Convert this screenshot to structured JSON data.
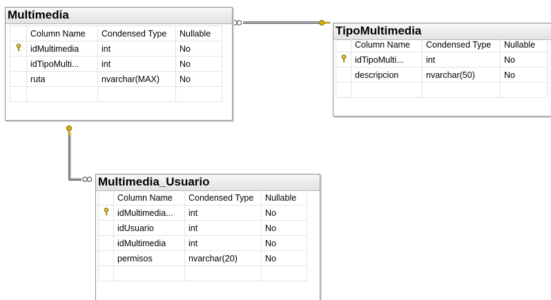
{
  "tables": {
    "multimedia": {
      "title": "Multimedia",
      "headers": [
        "Column Name",
        "Condensed Type",
        "Nullable"
      ],
      "rows": [
        {
          "key": true,
          "name": "idMultimedia",
          "type": "int",
          "nullable": "No"
        },
        {
          "key": false,
          "name": "idTipoMulti...",
          "type": "int",
          "nullable": "No"
        },
        {
          "key": false,
          "name": "ruta",
          "type": "nvarchar(MAX)",
          "nullable": "No"
        }
      ]
    },
    "tipo": {
      "title": "TipoMultimedia",
      "headers": [
        "Column Name",
        "Condensed Type",
        "Nullable"
      ],
      "rows": [
        {
          "key": true,
          "name": "idTipoMulti...",
          "type": "int",
          "nullable": "No"
        },
        {
          "key": false,
          "name": "descripcion",
          "type": "nvarchar(50)",
          "nullable": "No"
        }
      ]
    },
    "usuario": {
      "title": "Multimedia_Usuario",
      "headers": [
        "Column Name",
        "Condensed Type",
        "Nullable"
      ],
      "rows": [
        {
          "key": true,
          "name": "idMultimedia...",
          "type": "int",
          "nullable": "No"
        },
        {
          "key": false,
          "name": "idUsuario",
          "type": "int",
          "nullable": "No"
        },
        {
          "key": false,
          "name": "idMultimedia",
          "type": "int",
          "nullable": "No"
        },
        {
          "key": false,
          "name": "permisos",
          "type": "nvarchar(20)",
          "nullable": "No"
        }
      ]
    }
  },
  "colors": {
    "border": "#8c8c8c",
    "key_icon": "#d4b000",
    "relation_line": "#404040"
  }
}
